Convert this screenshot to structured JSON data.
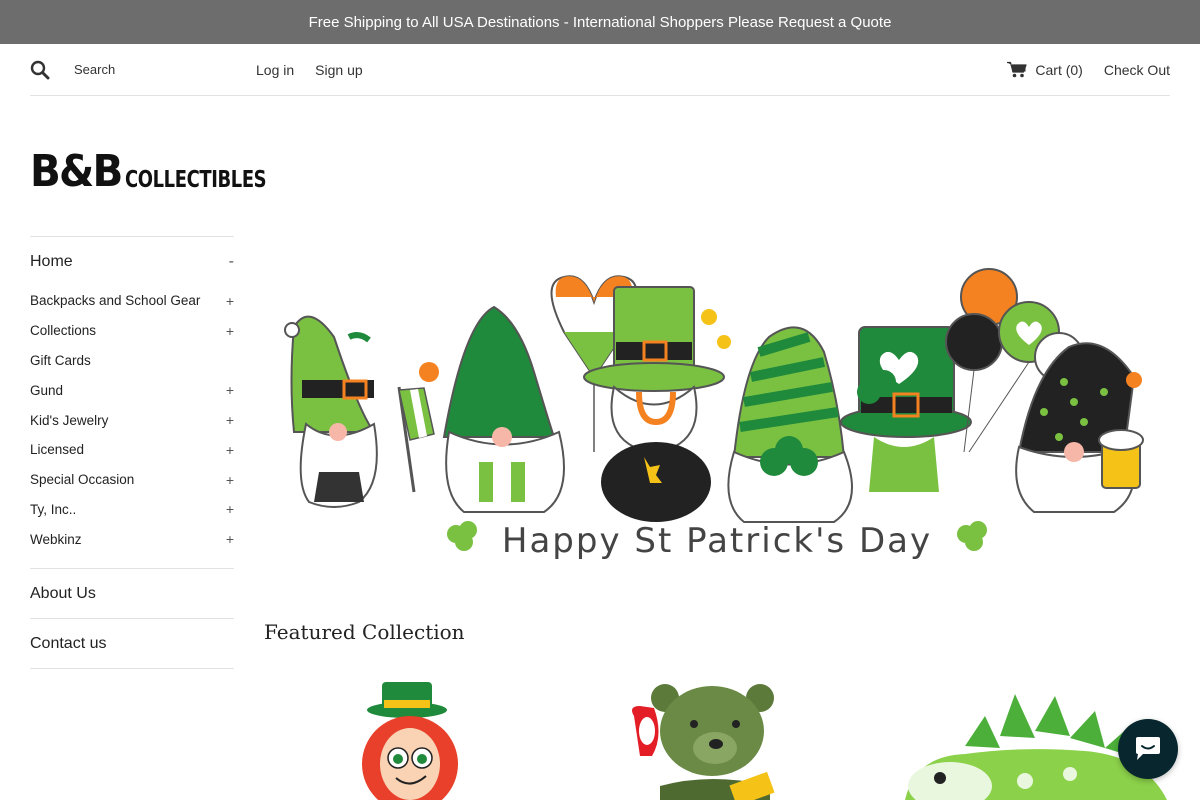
{
  "announcement": "Free Shipping to All USA Destinations - International Shoppers Please Request a Quote",
  "header": {
    "search_label": "Search",
    "search_placeholder": "Search",
    "login": "Log in",
    "signup": "Sign up",
    "cart_label": "Cart",
    "cart_count": "(0)",
    "checkout": "Check Out"
  },
  "logo": {
    "big": "B&B",
    "small": "COLLECTIBLES"
  },
  "sidebar": {
    "home": {
      "label": "Home",
      "toggle": "-"
    },
    "sub_items": [
      {
        "label": "Backpacks and School Gear",
        "toggle": "+"
      },
      {
        "label": "Collections",
        "toggle": "+"
      },
      {
        "label": "Gift Cards",
        "toggle": ""
      },
      {
        "label": "Gund",
        "toggle": "+"
      },
      {
        "label": "Kid's Jewelry",
        "toggle": "+"
      },
      {
        "label": "Licensed",
        "toggle": "+"
      },
      {
        "label": "Special Occasion",
        "toggle": "+"
      },
      {
        "label": "Ty, Inc..",
        "toggle": "+"
      },
      {
        "label": "Webkinz",
        "toggle": "+"
      }
    ],
    "about": "About Us",
    "contact": "Contact us"
  },
  "hero": {
    "caption": "Happy St Patrick's Day"
  },
  "featured": {
    "title": "Featured Collection"
  },
  "colors": {
    "announce_bg": "#6d6d6d",
    "chat_bg": "#08262e",
    "green": "#7ac142",
    "dark_green": "#1f8a3b",
    "orange": "#f58220"
  }
}
